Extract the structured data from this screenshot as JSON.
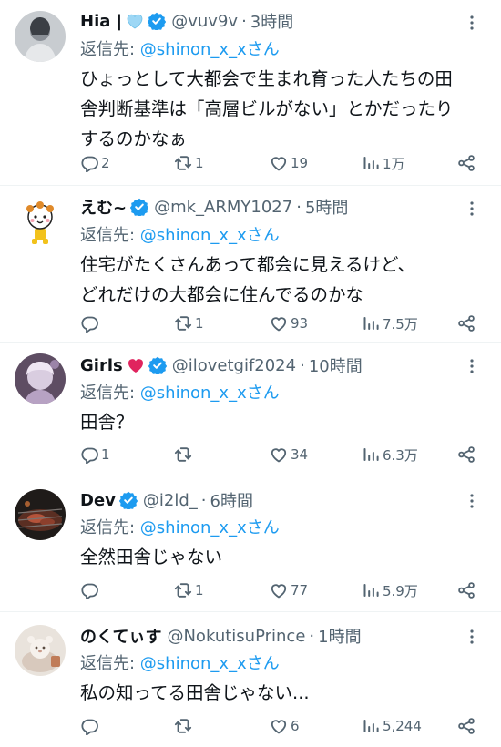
{
  "colors": {
    "text": "#0f1419",
    "secondary": "#536471",
    "accent": "#1d9bf0",
    "divider": "#eff3f4",
    "heart": "#e0245e"
  },
  "tweets": [
    {
      "name": "Hia |",
      "emoji": "light-blue-heart-icon",
      "verified": true,
      "handle": "@vuv9v",
      "time": "3時間",
      "reply_prefix": "返信先: ",
      "reply_to": "@shinon_x_xさん",
      "text_lines": [
        "ひょっとして大都会で生まれ育った人たちの田",
        "舎判断基準は「高層ビルがない」とかだったり",
        "するのかなぁ"
      ],
      "replies": "2",
      "retweets": "1",
      "likes": "19",
      "views": "1万"
    },
    {
      "name": "えむ~",
      "verified": true,
      "handle": "@mk_ARMY1027",
      "time": "5時間",
      "reply_prefix": "返信先: ",
      "reply_to": "@shinon_x_xさん",
      "text_lines": [
        "住宅がたくさんあって都会に見えるけど、",
        "どれだけの大都会に住んでるのかな"
      ],
      "replies": "",
      "retweets": "1",
      "likes": "93",
      "views": "7.5万"
    },
    {
      "name": "Girls",
      "emoji": "red-heart-icon",
      "verified": true,
      "handle": "@ilovetgif2024",
      "time": "10時間",
      "reply_prefix": "返信先: ",
      "reply_to": "@shinon_x_xさん",
      "text_lines": [
        "田舎？"
      ],
      "replies": "1",
      "retweets": "",
      "likes": "34",
      "views": "6.3万"
    },
    {
      "name": "Dev",
      "verified": true,
      "handle": "@i2ld_",
      "time": "6時間",
      "reply_prefix": "返信先: ",
      "reply_to": "@shinon_x_xさん",
      "text_lines": [
        "全然田舎じゃない"
      ],
      "replies": "",
      "retweets": "1",
      "likes": "77",
      "views": "5.9万"
    },
    {
      "name": "のくてぃす",
      "verified": false,
      "handle": "@NokutisuPrince",
      "time": "1時間",
      "reply_prefix": "返信先: ",
      "reply_to": "@shinon_x_xさん",
      "text_lines": [
        "私の知ってる田舎じゃない..."
      ],
      "replies": "",
      "retweets": "",
      "likes": "6",
      "views": "5,244"
    }
  ]
}
